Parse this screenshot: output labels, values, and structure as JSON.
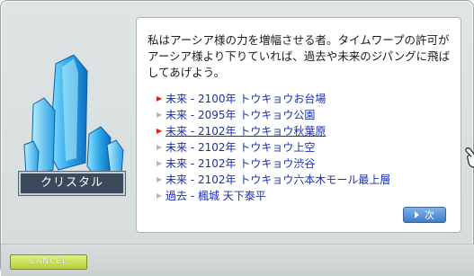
{
  "npc": {
    "name": "クリスタル",
    "portrait_icon": "crystal-icon"
  },
  "dialog": {
    "message_lines": [
      "私はアーシア様の力を増幅させる者。タイムワープの許可が",
      "アーシア様より下りていれば、過去や未来のジパングに飛ば",
      "してあげよう。"
    ],
    "options": [
      {
        "label": "未来 - 2100年 トウキョウお台場",
        "bullet": "red"
      },
      {
        "label": "未来 - 2095年 トウキョウ公園",
        "bullet": "gray"
      },
      {
        "label": "未来 - 2102年 トウキョウ秋葉原",
        "bullet": "red",
        "selected": true
      },
      {
        "label": "未来 - 2102年 トウキョウ上空",
        "bullet": "gray"
      },
      {
        "label": "未来 - 2102年 トウキョウ渋谷",
        "bullet": "gray"
      },
      {
        "label": "未来 - 2102年 トウキョウ六本木モール最上層",
        "bullet": "gray"
      },
      {
        "label": "過去 - 楓城  天下泰平",
        "bullet": "gray"
      }
    ],
    "next_label": "次",
    "cursor_icon": "pointing-hand-icon"
  },
  "footer": {
    "cancel_label": "CANCEL"
  },
  "colors": {
    "option_text": "#1d2fa8",
    "bullet_active": "#e02020",
    "bullet_inactive": "#b8b8b8",
    "nameplate_bg": "#3a4a5c",
    "cancel_bg": "#c4db52"
  }
}
